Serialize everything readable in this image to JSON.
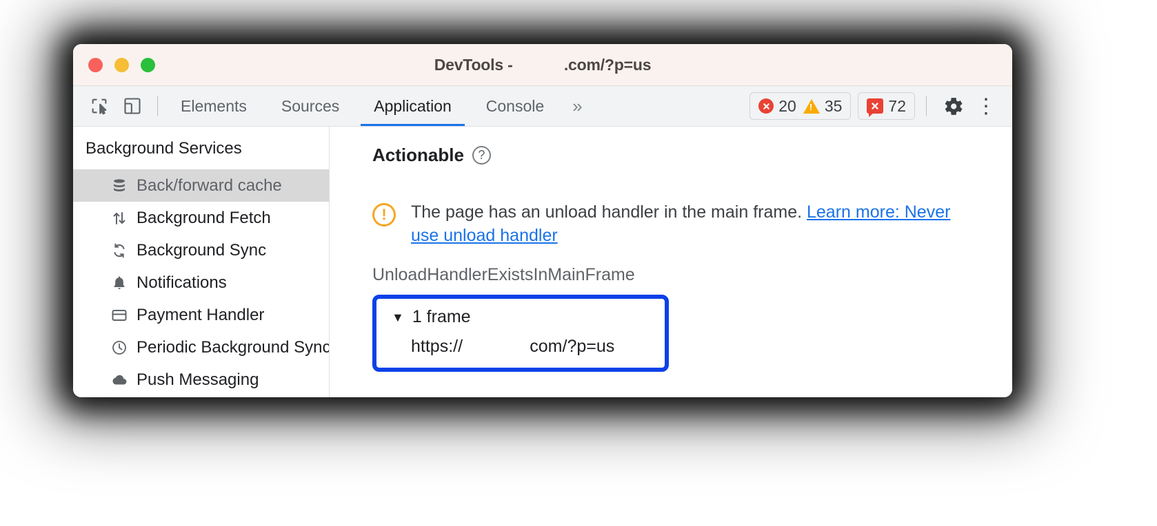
{
  "window": {
    "title": "DevTools -            .com/?p=us",
    "traffic_lights": [
      "close",
      "minimize",
      "zoom"
    ]
  },
  "toolbar": {
    "inspect_icon": "inspect-cursor-icon",
    "device_icon": "device-toolbar-icon",
    "tabs": [
      {
        "label": "Elements",
        "active": false
      },
      {
        "label": "Sources",
        "active": false
      },
      {
        "label": "Application",
        "active": true
      },
      {
        "label": "Console",
        "active": false
      }
    ],
    "more_tabs_label": "»",
    "badges": [
      {
        "kind": "errors",
        "icon": "error-circle-icon",
        "count": "20"
      },
      {
        "kind": "warnings",
        "icon": "warning-triangle-icon",
        "count": "35"
      }
    ],
    "issues_badge": {
      "icon": "issues-bubble-icon",
      "count": "72"
    },
    "settings_label": "gear-icon",
    "menu_label": "⋮"
  },
  "sidebar": {
    "title": "Background Services",
    "items": [
      {
        "label": "Back/forward cache",
        "icon": "database-icon",
        "selected": true
      },
      {
        "label": "Background Fetch",
        "icon": "arrows-up-down-icon",
        "selected": false
      },
      {
        "label": "Background Sync",
        "icon": "sync-icon",
        "selected": false
      },
      {
        "label": "Notifications",
        "icon": "bell-icon",
        "selected": false
      },
      {
        "label": "Payment Handler",
        "icon": "credit-card-icon",
        "selected": false
      },
      {
        "label": "Periodic Background Sync",
        "icon": "clock-icon",
        "selected": false
      },
      {
        "label": "Push Messaging",
        "icon": "cloud-icon",
        "selected": false
      }
    ]
  },
  "main": {
    "heading": "Actionable",
    "help_glyph": "?",
    "issue": {
      "icon": "warning-exclamation-circle-icon",
      "message": "The page has an unload handler in the main frame. ",
      "link_text": "Learn more: Never use unload handler"
    },
    "reason_code": "UnloadHandlerExistsInMainFrame",
    "frame_tree": {
      "caret": "▼",
      "label": "1 frame",
      "url": "https://              com/?p=us"
    }
  },
  "colors": {
    "accent": "#1a73e8",
    "highlight_box": "#0b41e8",
    "error": "#e94235",
    "warning": "#f9ab00",
    "warning_outline": "#f5a623",
    "titlebar_bg": "#faf2ee",
    "toolbar_bg": "#f1f3f4",
    "selected_row": "#d8d8d8"
  }
}
